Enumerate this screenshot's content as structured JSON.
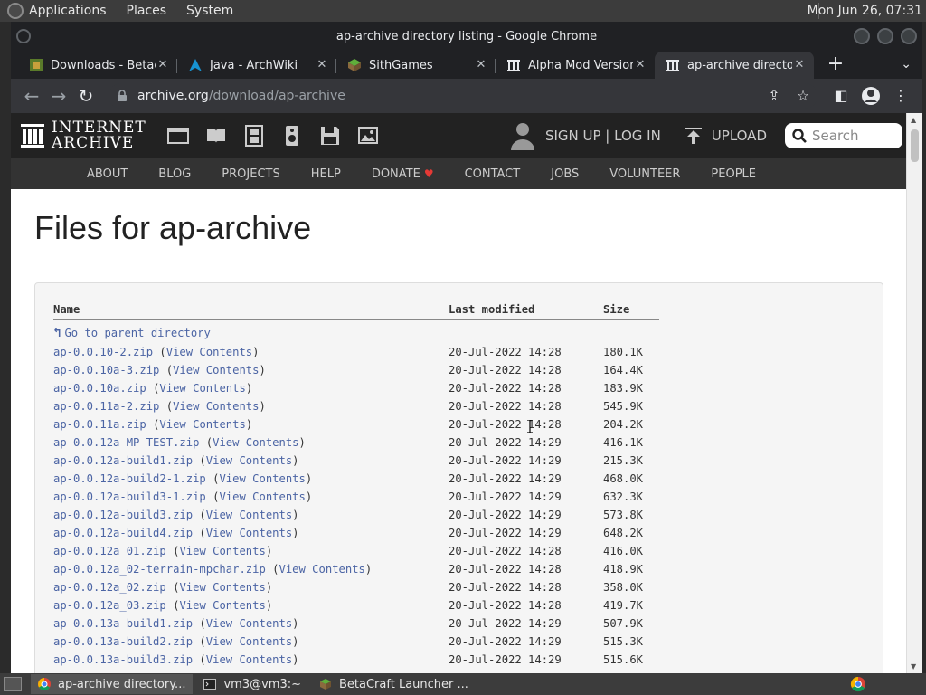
{
  "top_panel": {
    "menus": [
      "Applications",
      "Places",
      "System"
    ],
    "clock": "Mon Jun 26, 07:31"
  },
  "window": {
    "title": "ap-archive directory listing - Google Chrome"
  },
  "tabs": [
    {
      "title": "Downloads - Betacraft",
      "active": false
    },
    {
      "title": "Java - ArchWiki",
      "active": false
    },
    {
      "title": "SithGames",
      "active": false
    },
    {
      "title": "Alpha Mod Versions",
      "active": false
    },
    {
      "title": "ap-archive directory listing",
      "active": true
    }
  ],
  "toolbar": {
    "url_host": "archive.org",
    "url_path": "/download/ap-archive"
  },
  "ia_header": {
    "logo_line1": "INTERNET",
    "logo_line2": "ARCHIVE",
    "signup_login": "SIGN UP | LOG IN",
    "upload": "UPLOAD",
    "search_placeholder": "Search"
  },
  "subnav": [
    "ABOUT",
    "BLOG",
    "PROJECTS",
    "HELP",
    "DONATE",
    "CONTACT",
    "JOBS",
    "VOLUNTEER",
    "PEOPLE"
  ],
  "page": {
    "title": "Files for ap-archive",
    "columns": {
      "name": "Name",
      "modified": "Last modified",
      "size": "Size"
    },
    "parent_link": "Go to parent directory",
    "view_contents_label": "View Contents",
    "files": [
      {
        "name": "ap-0.0.10-2.zip",
        "modified": "20-Jul-2022 14:28",
        "size": "180.1K"
      },
      {
        "name": "ap-0.0.10a-3.zip",
        "modified": "20-Jul-2022 14:28",
        "size": "164.4K"
      },
      {
        "name": "ap-0.0.10a.zip",
        "modified": "20-Jul-2022 14:28",
        "size": "183.9K"
      },
      {
        "name": "ap-0.0.11a-2.zip",
        "modified": "20-Jul-2022 14:28",
        "size": "545.9K"
      },
      {
        "name": "ap-0.0.11a.zip",
        "modified": "20-Jul-2022 14:28",
        "size": "204.2K"
      },
      {
        "name": "ap-0.0.12a-MP-TEST.zip",
        "modified": "20-Jul-2022 14:29",
        "size": "416.1K"
      },
      {
        "name": "ap-0.0.12a-build1.zip",
        "modified": "20-Jul-2022 14:29",
        "size": "215.3K"
      },
      {
        "name": "ap-0.0.12a-build2-1.zip",
        "modified": "20-Jul-2022 14:29",
        "size": "468.0K"
      },
      {
        "name": "ap-0.0.12a-build3-1.zip",
        "modified": "20-Jul-2022 14:29",
        "size": "632.3K"
      },
      {
        "name": "ap-0.0.12a-build3.zip",
        "modified": "20-Jul-2022 14:29",
        "size": "573.8K"
      },
      {
        "name": "ap-0.0.12a-build4.zip",
        "modified": "20-Jul-2022 14:29",
        "size": "648.2K"
      },
      {
        "name": "ap-0.0.12a_01.zip",
        "modified": "20-Jul-2022 14:28",
        "size": "416.0K"
      },
      {
        "name": "ap-0.0.12a_02-terrain-mpchar.zip",
        "modified": "20-Jul-2022 14:28",
        "size": "418.9K"
      },
      {
        "name": "ap-0.0.12a_02.zip",
        "modified": "20-Jul-2022 14:28",
        "size": "358.0K"
      },
      {
        "name": "ap-0.0.12a_03.zip",
        "modified": "20-Jul-2022 14:28",
        "size": "419.7K"
      },
      {
        "name": "ap-0.0.13a-build1.zip",
        "modified": "20-Jul-2022 14:29",
        "size": "507.9K"
      },
      {
        "name": "ap-0.0.13a-build2.zip",
        "modified": "20-Jul-2022 14:29",
        "size": "515.3K"
      },
      {
        "name": "ap-0.0.13a-build3.zip",
        "modified": "20-Jul-2022 14:29",
        "size": "515.6K"
      }
    ]
  },
  "taskbar": {
    "tasks": [
      {
        "label": "ap-archive directory...",
        "active": true
      },
      {
        "label": "vm3@vm3:~",
        "active": false
      },
      {
        "label": "BetaCraft Launcher ...",
        "active": false
      }
    ]
  },
  "colors": {
    "link": "#4b64a4",
    "ia_header_bg": "#222222",
    "ia_subnav_bg": "#333333",
    "chrome_frame": "#202124",
    "chrome_toolbar": "#35363a"
  }
}
